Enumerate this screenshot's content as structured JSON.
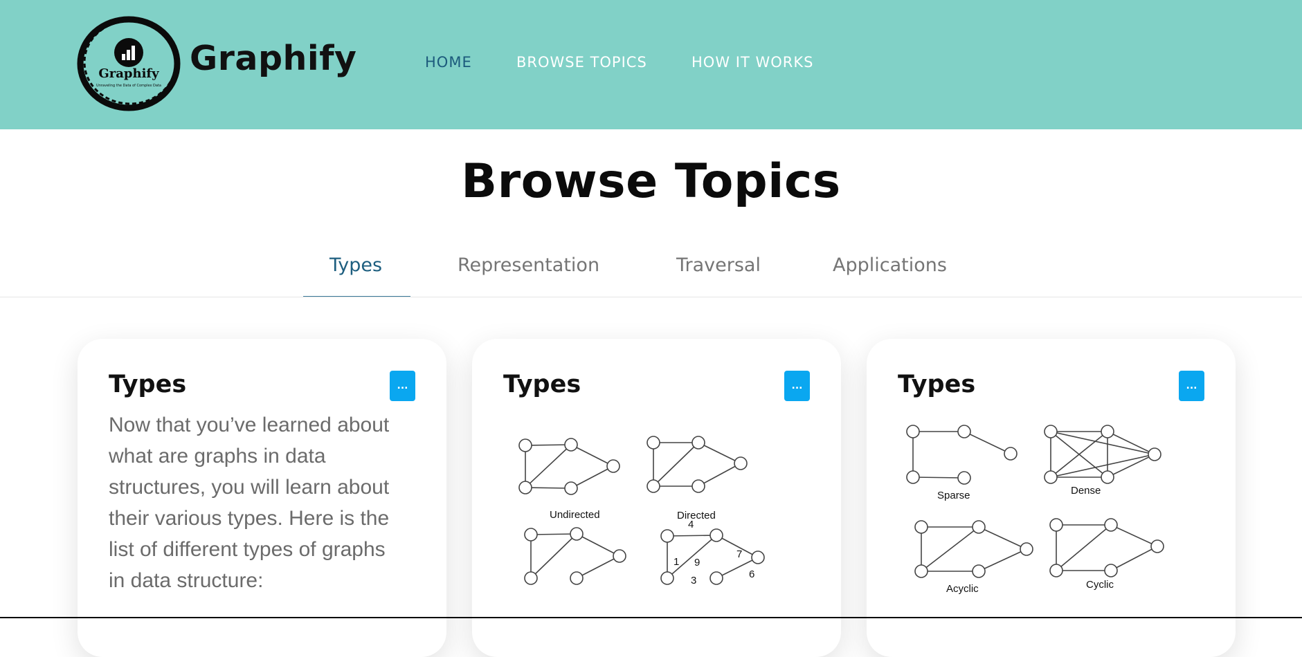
{
  "site": {
    "brand": "Graphify",
    "logo_text": "Graphify",
    "logo_tagline": "Unraveling the Data of Complex Data"
  },
  "nav": {
    "items": [
      {
        "label": "HOME",
        "active": true
      },
      {
        "label": "BROWSE TOPICS",
        "active": false
      },
      {
        "label": "HOW IT WORKS",
        "active": false
      }
    ]
  },
  "page": {
    "title": "Browse Topics"
  },
  "tabs": [
    {
      "label": "Types",
      "active": true
    },
    {
      "label": "Representation",
      "active": false
    },
    {
      "label": "Traversal",
      "active": false
    },
    {
      "label": "Applications",
      "active": false
    }
  ],
  "cards": [
    {
      "title": "Types",
      "menu_label": "...",
      "text": "Now that you’ve learned about what are graphs in data structures, you will learn about their various types. Here is the list of different types of graphs in data structure:"
    },
    {
      "title": "Types",
      "menu_label": "...",
      "diagram_labels": [
        "Undirected",
        "Directed"
      ],
      "edge_weights": [
        "4",
        "7",
        "1",
        "9",
        "3",
        "6"
      ]
    },
    {
      "title": "Types",
      "menu_label": "...",
      "diagram_labels": [
        "Sparse",
        "Dense",
        "Acyclic",
        "Cyclic"
      ]
    }
  ],
  "colors": {
    "header_bg": "#81d1c7",
    "nav_active": "#1c5a7c",
    "tab_active": "#1d5e7f",
    "card_button": "#0aa7f0"
  }
}
